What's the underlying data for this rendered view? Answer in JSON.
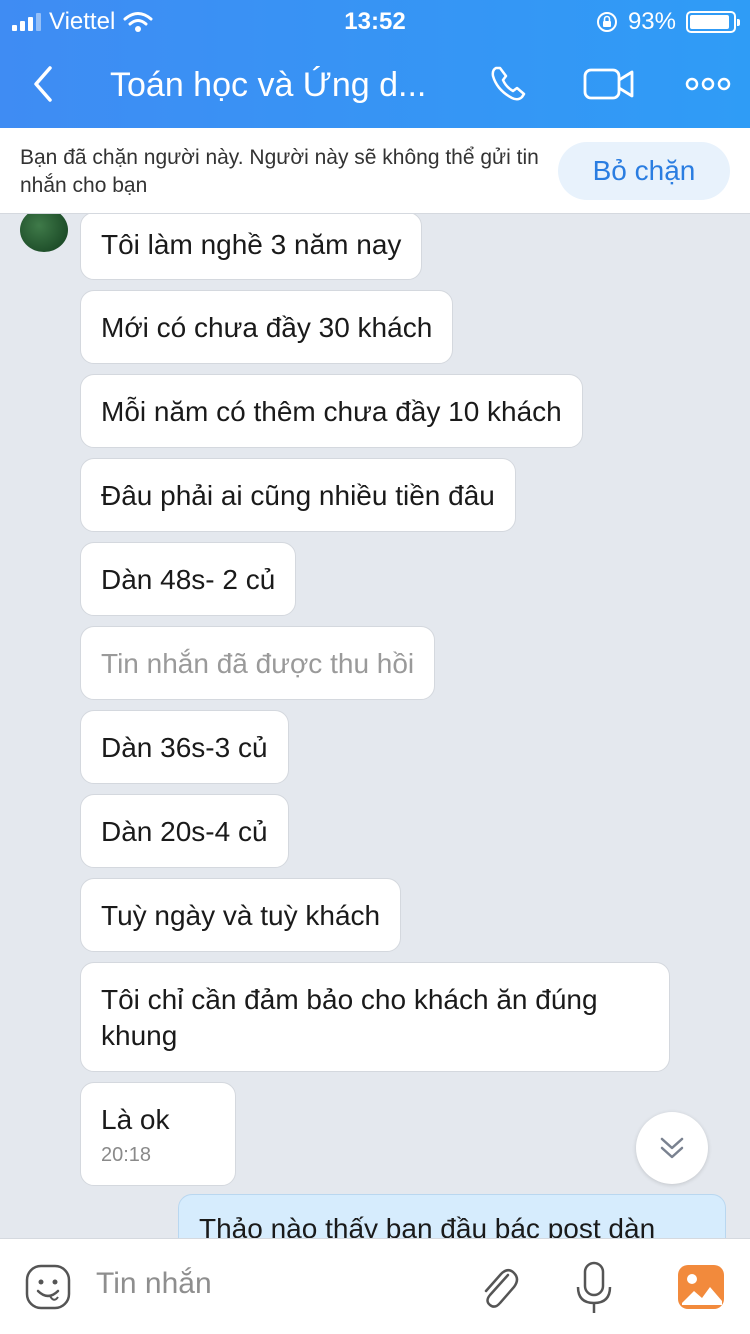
{
  "status_bar": {
    "carrier": "Viettel",
    "time": "13:52",
    "battery": "93%",
    "battery_level": 0.93
  },
  "header": {
    "title": "Toán học và Ứng d...",
    "icons": [
      "back-chevron-icon",
      "phone-icon",
      "video-call-icon",
      "more-icon"
    ]
  },
  "block_banner": {
    "text": "Bạn đã chặn người này. Người này sẽ không thể gửi tin nhắn cho bạn",
    "unblock_label": "Bỏ chặn"
  },
  "messages": [
    {
      "text": "Tôi làm nghề 3 năm nay"
    },
    {
      "text": "Mới có chưa đầy 30 khách"
    },
    {
      "text": "Mỗi năm có thêm chưa đầy 10 khách"
    },
    {
      "text": "Đâu phải ai cũng nhiều tiền đâu"
    },
    {
      "text": "Dàn 48s- 2 củ"
    },
    {
      "text": "Tin nhắn đã được thu hồi",
      "recalled": true
    },
    {
      "text": "Dàn 36s-3 củ"
    },
    {
      "text": "Dàn 20s-4 củ"
    },
    {
      "text": "Tuỳ ngày và tuỳ khách"
    },
    {
      "text": "Tôi chỉ cần đảm bảo cho khách ăn đúng khung"
    },
    {
      "text": "Là ok",
      "time": "20:18"
    }
  ],
  "sent_message": {
    "text": "Thảo nào thấy bạn đầu bác post dàn"
  },
  "composer": {
    "placeholder": "Tin nhắn",
    "icons": [
      "emoji-icon",
      "attachment-icon",
      "microphone-icon",
      "photo-icon"
    ]
  },
  "colors": {
    "header": "#3f8cf3",
    "accent": "#2a7de1",
    "chat_background": "#e4e8ee",
    "sent_bubble": "#d6ecfd"
  }
}
